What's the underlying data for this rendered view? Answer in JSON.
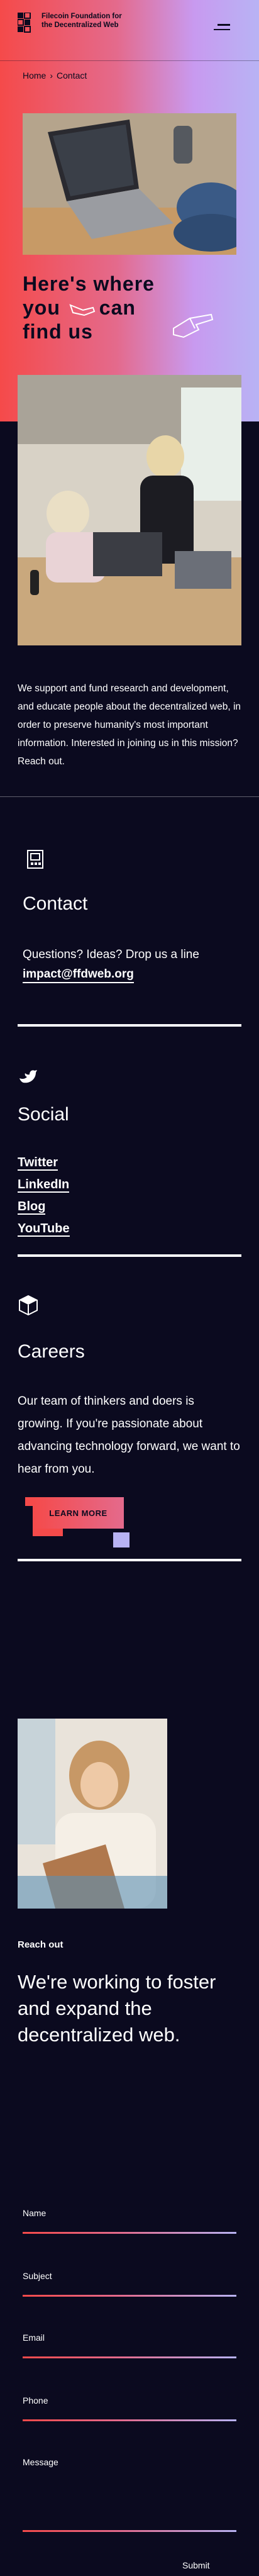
{
  "brand": {
    "name": "Filecoin Foundation for the Decentralized Web",
    "accent_red": "#f54a4a",
    "accent_pink": "#e46a8c",
    "accent_lavender": "#b8b3f4",
    "background": "#0b0a1f"
  },
  "header": {
    "menu_icon": "hamburger-icon"
  },
  "breadcrumb": {
    "home": "Home",
    "separator": "›",
    "current": "Contact"
  },
  "hero": {
    "title_line1": "Here's where",
    "title_line2a": "you",
    "title_line2b": "can",
    "title_line3": "find us"
  },
  "intro": {
    "text": "We support and fund research and development, and educate people about the decentralized web, in order to preserve humanity's most important information. Interested in joining us in this mission? Reach out."
  },
  "contact": {
    "icon": "phone-icon",
    "title": "Contact",
    "text": "Questions? Ideas? Drop us a line",
    "email": "impact@ffdweb.org"
  },
  "social": {
    "icon": "bird-icon",
    "title": "Social",
    "links": [
      {
        "label": "Twitter"
      },
      {
        "label": "LinkedIn"
      },
      {
        "label": "Blog"
      },
      {
        "label": "YouTube"
      }
    ]
  },
  "careers": {
    "icon": "cube-icon",
    "title": "Careers",
    "text": "Our team of thinkers and doers is growing. If you're passionate about advancing technology forward, we want to hear from you.",
    "button": "LEARN MORE"
  },
  "reach_out": {
    "label": "Reach out",
    "title": "We're working to foster and expand the decentralized web."
  },
  "form": {
    "fields": [
      {
        "label": "Name"
      },
      {
        "label": "Subject"
      },
      {
        "label": "Email"
      },
      {
        "label": "Phone"
      },
      {
        "label": "Message"
      }
    ],
    "submit": "Submit"
  }
}
